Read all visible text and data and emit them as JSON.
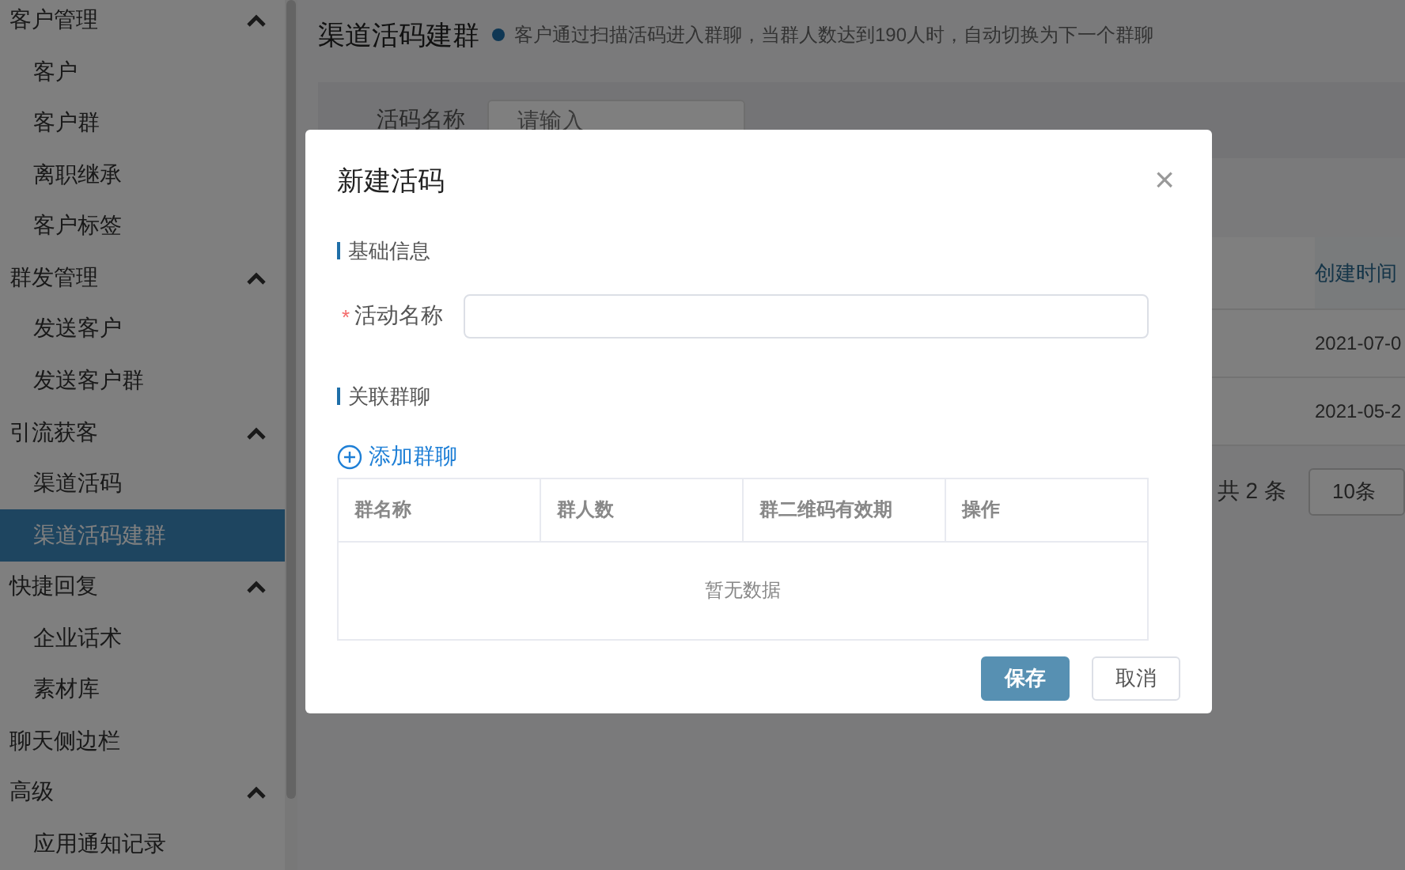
{
  "sidebar": {
    "items": [
      {
        "kind": "group",
        "label": "客户管理",
        "expanded": true,
        "children": [
          {
            "label": "客户",
            "selected": false
          },
          {
            "label": "客户群",
            "selected": false
          },
          {
            "label": "离职继承",
            "selected": false
          },
          {
            "label": "客户标签",
            "selected": false
          }
        ]
      },
      {
        "kind": "group",
        "label": "群发管理",
        "expanded": true,
        "children": [
          {
            "label": "发送客户",
            "selected": false
          },
          {
            "label": "发送客户群",
            "selected": false
          }
        ]
      },
      {
        "kind": "group",
        "label": "引流获客",
        "expanded": true,
        "children": [
          {
            "label": "渠道活码",
            "selected": false
          },
          {
            "label": "渠道活码建群",
            "selected": true
          }
        ]
      },
      {
        "kind": "group",
        "label": "快捷回复",
        "expanded": true,
        "children": [
          {
            "label": "企业话术",
            "selected": false
          },
          {
            "label": "素材库",
            "selected": false
          }
        ]
      },
      {
        "kind": "link",
        "label": "聊天侧边栏"
      },
      {
        "kind": "group",
        "label": "高级",
        "expanded": true,
        "children": [
          {
            "label": "应用通知记录",
            "selected": false
          }
        ]
      }
    ]
  },
  "page": {
    "title": "渠道活码建群",
    "hint": "客户通过扫描活码进入群聊，当群人数达到190人时，自动切换为下一个群聊",
    "filter": {
      "label": "活码名称",
      "placeholder": "请输入"
    },
    "table": {
      "columns": [
        "创建时间"
      ],
      "rows": [
        [
          "2021-07-0"
        ],
        [
          "2021-05-2"
        ]
      ]
    },
    "pagination": {
      "total": "共 2 条",
      "page_size": "10条"
    }
  },
  "modal": {
    "title": "新建活码",
    "close": "×",
    "sections": [
      {
        "title": "基础信息"
      },
      {
        "title": "关联群聊"
      }
    ],
    "field": {
      "label": "活动名称",
      "required_mark": "*"
    },
    "add_button": "添加群聊",
    "table": {
      "columns": [
        "群名称",
        "群人数",
        "群二维码有效期",
        "操作"
      ],
      "empty": "暂无数据"
    },
    "buttons": [
      {
        "label": "保存",
        "kind": "primary"
      },
      {
        "label": "取消",
        "kind": "default"
      }
    ]
  }
}
